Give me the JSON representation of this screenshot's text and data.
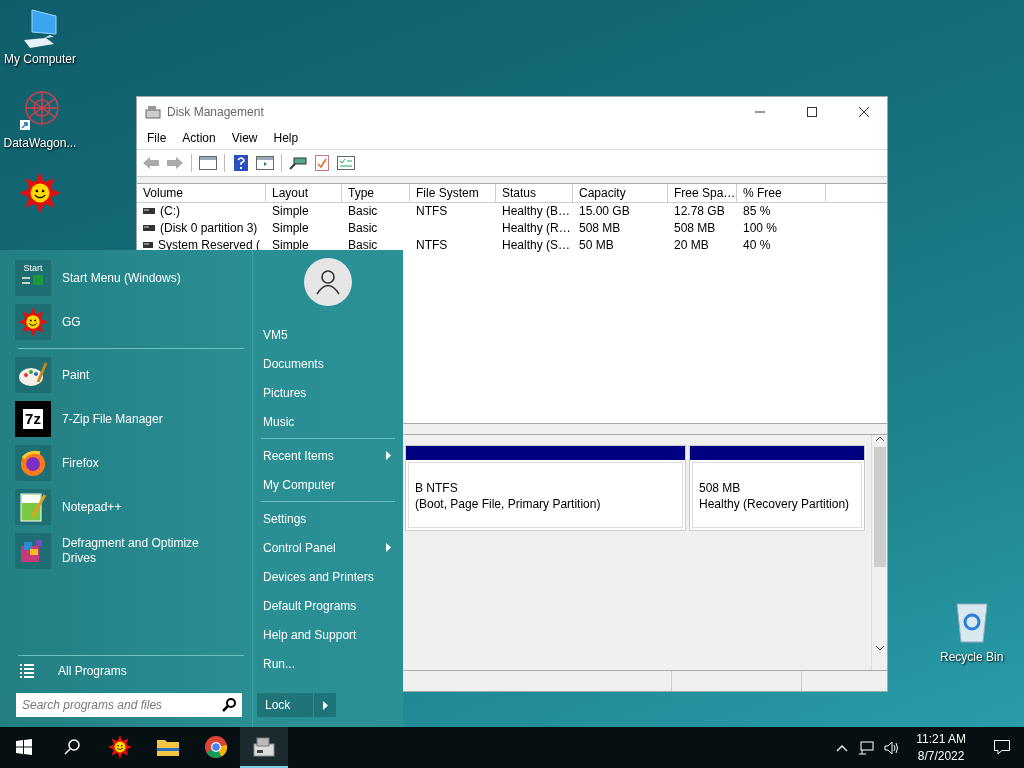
{
  "desktop_icons": [
    {
      "kind": "computer",
      "label": "My Computer"
    },
    {
      "kind": "web",
      "label": "DataWagon..."
    },
    {
      "kind": "sun"
    }
  ],
  "recycle_bin": {
    "label": "Recycle Bin"
  },
  "window": {
    "title": "Disk Management",
    "menu": [
      "File",
      "Action",
      "View",
      "Help"
    ],
    "columns": [
      "Volume",
      "Layout",
      "Type",
      "File System",
      "Status",
      "Capacity",
      "Free Spa…",
      "% Free"
    ],
    "rows": [
      {
        "cells": [
          "(C:)",
          "Simple",
          "Basic",
          "NTFS",
          "Healthy (B…",
          "15.00 GB",
          "12.78 GB",
          "85 %"
        ]
      },
      {
        "cells": [
          "(Disk 0 partition 3)",
          "Simple",
          "Basic",
          "",
          "Healthy (R…",
          "508 MB",
          "508 MB",
          "100 %"
        ]
      },
      {
        "cells": [
          "System Reserved (",
          "Simple",
          "Basic",
          "NTFS",
          "Healthy (S…",
          "50 MB",
          "20 MB",
          "40 %"
        ]
      }
    ],
    "partitions": [
      {
        "size": "B NTFS",
        "status": "(Boot, Page File, Primary Partition)"
      },
      {
        "size": "508 MB",
        "status": "Healthy (Recovery Partition)"
      }
    ]
  },
  "start_menu": {
    "pinned": [
      {
        "kind": "startmenu",
        "label": "Start Menu (Windows)",
        "icon_text": "Start"
      },
      {
        "kind": "sun",
        "label": "GG"
      },
      {
        "kind": "paint",
        "label": "Paint"
      },
      {
        "kind": "sevenzip",
        "label": "7-Zip File Manager",
        "icon_text": "7z"
      },
      {
        "kind": "firefox",
        "label": "Firefox"
      },
      {
        "kind": "notepad",
        "label": "Notepad++"
      },
      {
        "kind": "defrag",
        "label": "Defragment and Optimize Drives"
      }
    ],
    "all_programs": "All Programs",
    "search": {
      "placeholder": "Search programs and files"
    },
    "places": [
      {
        "items": [
          {
            "label": "VM5",
            "submenu": false
          },
          {
            "label": "Documents",
            "submenu": false
          },
          {
            "label": "Pictures",
            "submenu": false
          },
          {
            "label": "Music",
            "submenu": false
          }
        ]
      },
      {
        "items": [
          {
            "label": "Recent Items",
            "submenu": true
          },
          {
            "label": "My Computer",
            "submenu": false
          }
        ]
      },
      {
        "items": [
          {
            "label": "Settings",
            "submenu": false
          },
          {
            "label": "Control Panel",
            "submenu": true
          },
          {
            "label": "Devices and Printers",
            "submenu": false
          },
          {
            "label": "Default Programs",
            "submenu": false
          },
          {
            "label": "Help and Support",
            "submenu": false
          },
          {
            "label": "Run...",
            "submenu": false
          }
        ]
      }
    ],
    "lock": "Lock"
  },
  "taskbar": {
    "apps": [
      {
        "kind": "sun",
        "selected": false
      },
      {
        "kind": "folder",
        "selected": false
      },
      {
        "kind": "chrome",
        "selected": false
      },
      {
        "kind": "diskmgmt",
        "selected": true
      }
    ],
    "time": "11:21 AM",
    "date": "8/7/2022"
  }
}
